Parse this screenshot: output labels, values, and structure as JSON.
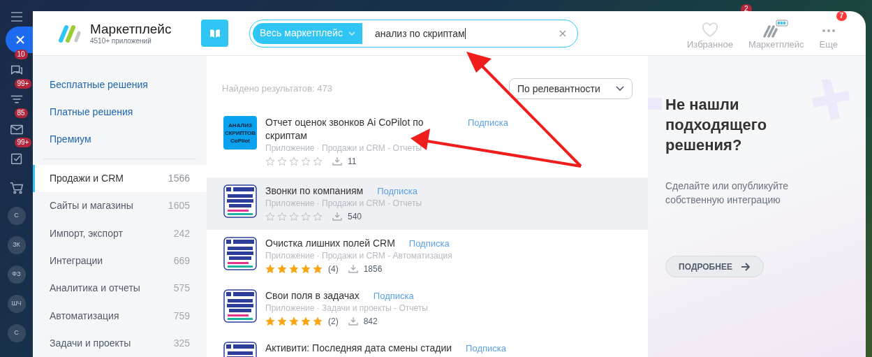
{
  "background_sidebar": {
    "items": [
      {
        "kind": "chat",
        "badge": "10"
      },
      {
        "kind": "funnel",
        "badge": "99+"
      },
      {
        "kind": "mail",
        "badge": "85"
      },
      {
        "kind": "task",
        "badge": "99+"
      },
      {
        "kind": "cart"
      },
      {
        "kind": "avatar",
        "initials": "С"
      },
      {
        "kind": "avatar",
        "initials": "ЗК"
      },
      {
        "kind": "avatar",
        "initials": "ФЗ"
      },
      {
        "kind": "avatar",
        "initials": "ШЧ"
      },
      {
        "kind": "avatar",
        "initials": "С"
      }
    ],
    "top_badge": "2"
  },
  "header": {
    "title": "Маркетплейс",
    "subtitle": "4510+ приложений",
    "search": {
      "scope": "Весь маркетплейс",
      "value": "анализ по скриптам"
    },
    "nav": [
      {
        "kind": "heart",
        "label": "Избранное"
      },
      {
        "kind": "market",
        "label": "Маркетплейс"
      },
      {
        "kind": "more",
        "label": "Еще",
        "badge": "7"
      }
    ]
  },
  "sidebar": {
    "links": [
      "Бесплатные решения",
      "Платные решения",
      "Премиум"
    ],
    "categories": [
      {
        "label": "Продажи и CRM",
        "count": "1566",
        "selected": true
      },
      {
        "label": "Сайты и магазины",
        "count": "1605",
        "selected": false
      },
      {
        "label": "Импорт, экспорт",
        "count": "242",
        "selected": false
      },
      {
        "label": "Интеграции",
        "count": "669",
        "selected": false
      },
      {
        "label": "Аналитика и отчеты",
        "count": "575",
        "selected": false
      },
      {
        "label": "Автоматизация",
        "count": "759",
        "selected": false
      },
      {
        "label": "Задачи и проекты",
        "count": "325",
        "selected": false
      }
    ]
  },
  "results": {
    "found": "Найдено результатов: 473",
    "sort": "По релевантности",
    "items": [
      {
        "kind": "text",
        "logo_lines": [
          "АНАЛИЗ",
          "СКРИПТОВ",
          "CoPilot"
        ],
        "title": "Отчет оценок звонков Ai CoPilot по скриптам",
        "badge": "Подписка",
        "meta": "Приложение · Продажи и CRM - Отчеты",
        "stars": 0,
        "downloads": "11",
        "hovered": false
      },
      {
        "kind": "tile",
        "title": "Звонки по компаниям",
        "badge": "Подписка",
        "meta": "Приложение · Продажи и CRM - Отчеты",
        "stars": 0,
        "downloads": "540",
        "hovered": true
      },
      {
        "kind": "tile",
        "title": "Очистка лишних полей CRM",
        "badge": "Подписка",
        "meta": "Приложение · Продажи и CRM - Автоматизация",
        "stars": 5,
        "reviews": "(4)",
        "downloads": "1856",
        "hovered": false
      },
      {
        "kind": "tile",
        "title": "Свои поля в задачах",
        "badge": "Подписка",
        "meta": "Приложение · Задачи и проекты - Отчеты",
        "stars": 5,
        "reviews": "(2)",
        "downloads": "842",
        "hovered": false
      },
      {
        "kind": "tile",
        "title": "Активити: Последняя дата смены стадии",
        "badge": "Подписка",
        "hovered": false
      }
    ]
  },
  "promo": {
    "title": "Не нашли подходящего решения?",
    "text": "Сделайте или опубликуйте собственную интеграцию",
    "button": "ПОДРОБНЕЕ"
  }
}
